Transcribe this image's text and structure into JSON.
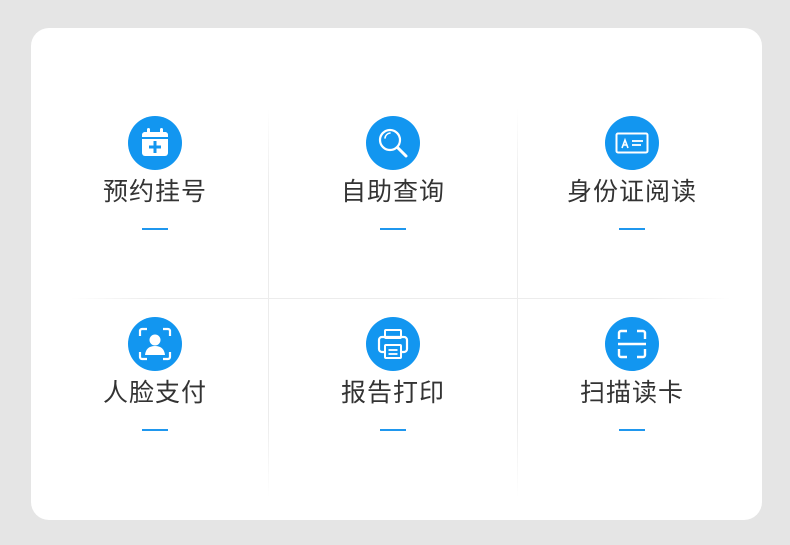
{
  "theme": {
    "accent": "#1296f0",
    "text": "#333333",
    "background": "#e5e5e5",
    "card": "#ffffff"
  },
  "tiles": [
    {
      "label": "预约挂号",
      "icon": "calendar-plus-icon"
    },
    {
      "label": "自助查询",
      "icon": "search-icon"
    },
    {
      "label": "身份证阅读",
      "icon": "id-card-icon"
    },
    {
      "label": "人脸支付",
      "icon": "face-scan-icon"
    },
    {
      "label": "报告打印",
      "icon": "printer-icon"
    },
    {
      "label": "扫描读卡",
      "icon": "scan-icon"
    }
  ]
}
